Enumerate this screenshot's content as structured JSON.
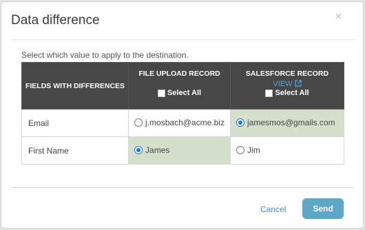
{
  "dialog": {
    "title": "Data difference",
    "close_glyph": "×",
    "instruction": "Select which value to apply to the destination."
  },
  "table": {
    "headers": {
      "fields": "FIELDS WITH DIFFERENCES",
      "file_upload": "FILE UPLOAD RECORD",
      "salesforce": "SALESFORCE RECORD",
      "view_link": "VIEW",
      "select_all": "Select All"
    },
    "rows": [
      {
        "field": "Email",
        "file_upload_value": "j.mosbach@acme.biz",
        "salesforce_value": "jamesmos@gmails.com",
        "selected": "salesforce"
      },
      {
        "field": "First Name",
        "file_upload_value": "James",
        "salesforce_value": "Jim",
        "selected": "file_upload"
      }
    ]
  },
  "footer": {
    "cancel_label": "Cancel",
    "send_label": "Send"
  },
  "colors": {
    "header_bg": "#474747",
    "selected_cell_bg": "#d5e0cc",
    "send_button_bg": "#5ea6c6",
    "link": "#3b8fd6"
  }
}
